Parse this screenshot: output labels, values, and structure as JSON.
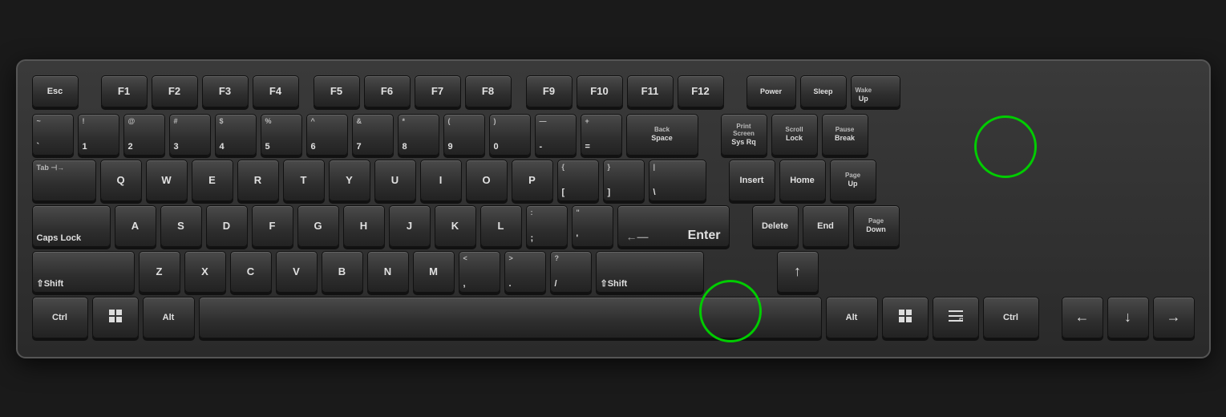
{
  "keyboard": {
    "title": "Keyboard",
    "highlighted_keys": [
      "Print Screen / Sys Rq",
      "Alt (right)"
    ],
    "rows": {
      "fn_row": [
        "Esc",
        "F1",
        "F2",
        "F3",
        "F4",
        "F5",
        "F6",
        "F7",
        "F8",
        "F9",
        "F10",
        "F11",
        "F12",
        "Power",
        "Sleep",
        "Wake Up"
      ],
      "number_row": [
        "~`",
        "!1",
        "@2",
        "#3",
        "$4",
        "%5",
        "^6",
        "&7",
        "*8",
        "(9",
        ")0",
        "—-",
        "+=",
        "Back Space",
        "Print Screen Sys Rq",
        "Scroll Lock",
        "Pause Break"
      ],
      "qwerty_row": [
        "Tab",
        "Q",
        "W",
        "E",
        "R",
        "T",
        "Y",
        "U",
        "I",
        "O",
        "P",
        "{[",
        "]}",
        "\\|",
        "Insert",
        "Home",
        "Page Up"
      ],
      "home_row": [
        "Caps Lock",
        "A",
        "S",
        "D",
        "F",
        "G",
        "H",
        "J",
        "K",
        "L",
        ";:",
        "'\"",
        "Enter",
        "Delete",
        "End",
        "Page Down"
      ],
      "shift_row": [
        "Shift",
        "Z",
        "X",
        "C",
        "V",
        "B",
        "N",
        "M",
        "<,",
        ">.",
        "?/",
        "Shift",
        "Up"
      ],
      "bottom_row": [
        "Ctrl",
        "Win",
        "Alt",
        "Space",
        "Alt",
        "Win",
        "Menu",
        "Ctrl",
        "Left",
        "Down",
        "Right"
      ]
    }
  }
}
